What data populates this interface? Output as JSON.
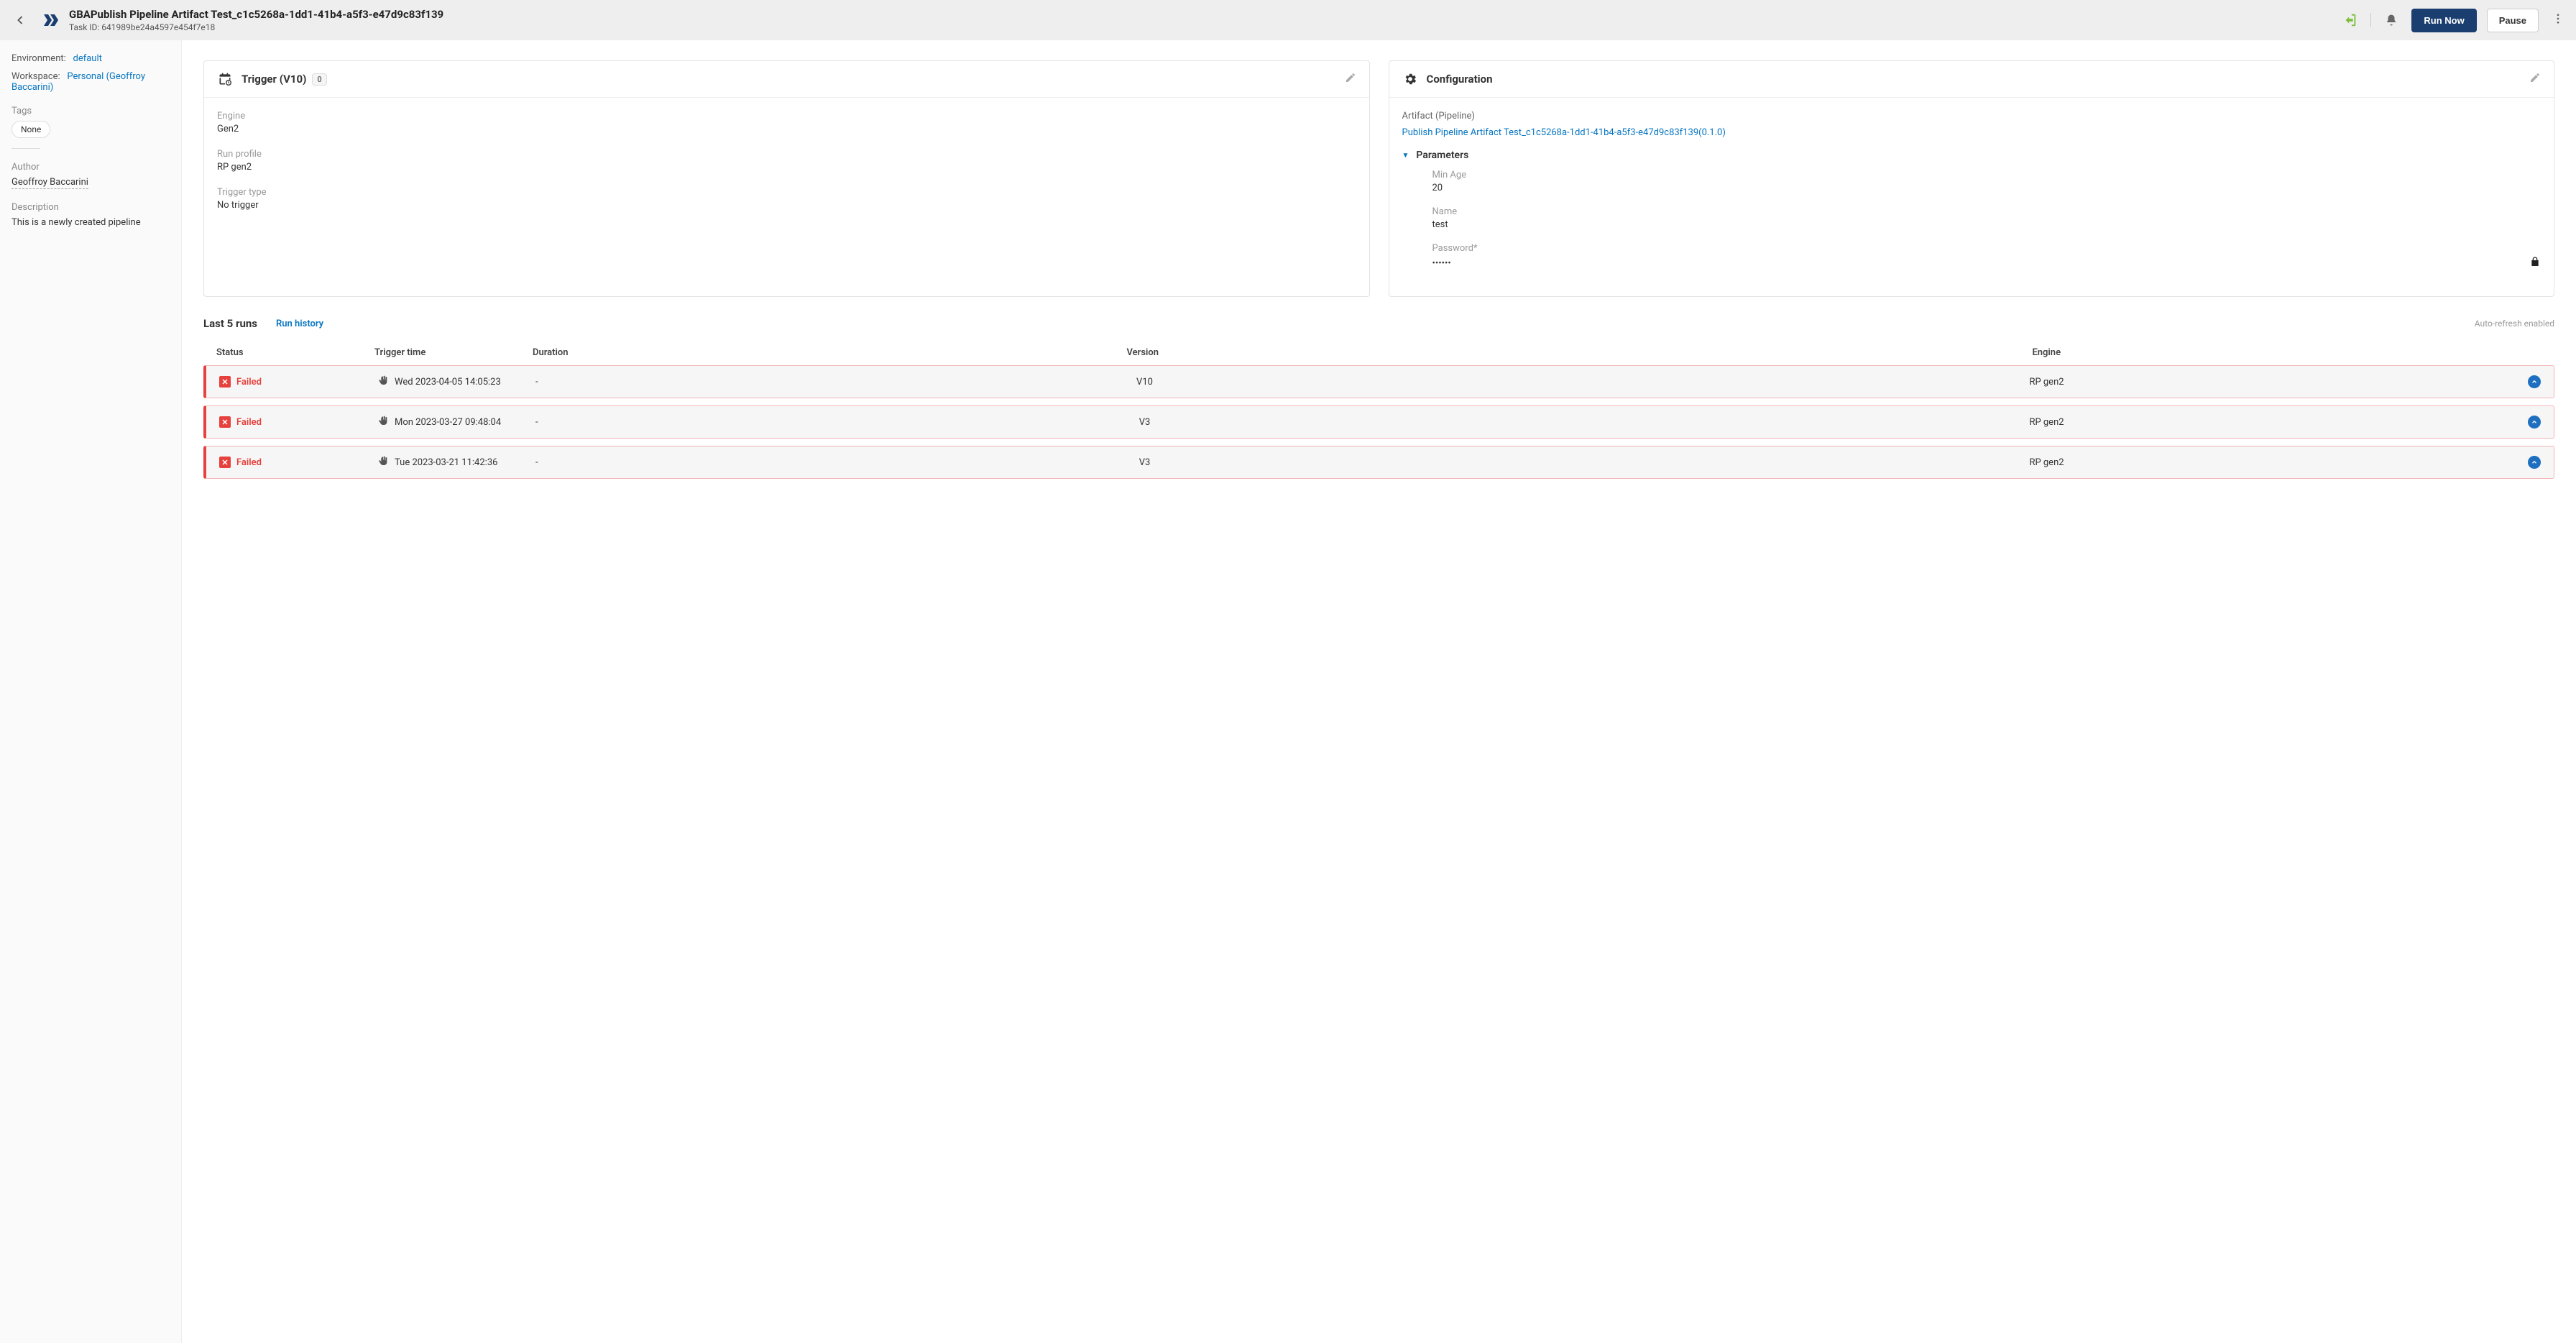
{
  "header": {
    "title": "GBAPublish Pipeline Artifact Test_c1c5268a-1dd1-41b4-a5f3-e47d9c83f139",
    "task_id_label": "Task ID: 641989be24a4597e454f7e18",
    "run_now": "Run Now",
    "pause": "Pause"
  },
  "sidebar": {
    "env_label": "Environment:",
    "env_value": "default",
    "ws_label": "Workspace:",
    "ws_value": "Personal (Geoffroy Baccarini)",
    "tags_label": "Tags",
    "tag_none": "None",
    "author_label": "Author",
    "author_value": "Geoffroy Baccarini",
    "desc_label": "Description",
    "desc_value": "This is a newly created pipeline"
  },
  "trigger": {
    "title": "Trigger (V10)",
    "badge": "0",
    "engine_label": "Engine",
    "engine_value": "Gen2",
    "profile_label": "Run profile",
    "profile_value": "RP gen2",
    "type_label": "Trigger type",
    "type_value": "No trigger"
  },
  "config": {
    "title": "Configuration",
    "artifact_label": "Artifact (Pipeline)",
    "artifact_link": "Publish Pipeline Artifact Test_c1c5268a-1dd1-41b4-a5f3-e47d9c83f139(0.1.0)",
    "params_label": "Parameters",
    "min_age_label": "Min Age",
    "min_age_value": "20",
    "name_label": "Name",
    "name_value": "test",
    "password_label": "Password*",
    "password_value": "••••••"
  },
  "runs": {
    "title": "Last 5 runs",
    "history_link": "Run history",
    "auto_refresh": "Auto-refresh enabled",
    "col_status": "Status",
    "col_trigger": "Trigger time",
    "col_duration": "Duration",
    "col_version": "Version",
    "col_engine": "Engine",
    "rows": [
      {
        "status": "Failed",
        "time": "Wed 2023-04-05 14:05:23",
        "duration": "-",
        "version": "V10",
        "engine": "RP gen2"
      },
      {
        "status": "Failed",
        "time": "Mon 2023-03-27 09:48:04",
        "duration": "-",
        "version": "V3",
        "engine": "RP gen2"
      },
      {
        "status": "Failed",
        "time": "Tue 2023-03-21 11:42:36",
        "duration": "-",
        "version": "V3",
        "engine": "RP gen2"
      }
    ]
  }
}
